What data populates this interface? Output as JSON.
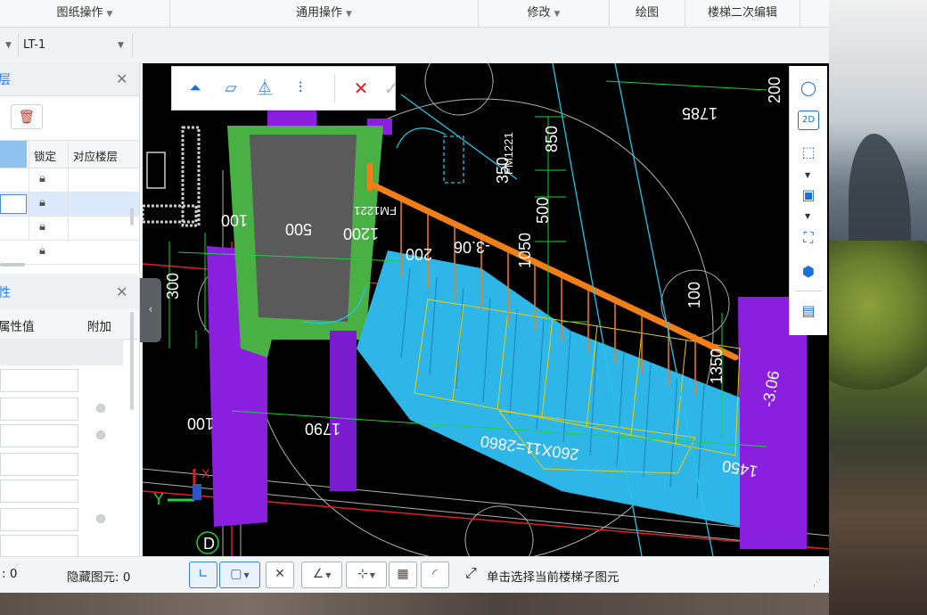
{
  "ribbon": {
    "groups": [
      {
        "label": "图纸操作"
      },
      {
        "label": "通用操作"
      },
      {
        "label": "修改"
      },
      {
        "label": "绘图"
      },
      {
        "label": "楼梯二次编辑"
      }
    ]
  },
  "toolbar": {
    "combo_left": "",
    "combo_stair": "LT-1"
  },
  "layer_panel": {
    "title": "层",
    "columns": [
      "锁定",
      "对应楼层"
    ],
    "rows": [
      {
        "locked": true
      },
      {
        "locked": true,
        "active": true
      },
      {
        "locked": true
      },
      {
        "locked": true
      }
    ]
  },
  "property_panel": {
    "title": "性",
    "columns": [
      "属性值",
      "附加"
    ]
  },
  "canvas": {
    "dimensions": [
      "1785",
      "200",
      "850",
      "350",
      "500",
      "1050",
      "1200",
      "1200",
      "500",
      "100",
      "300",
      "100",
      "1790",
      "260X11=2860",
      "1450",
      "1350",
      "-3.06",
      "200",
      "100",
      "100"
    ],
    "labels": [
      "FM1221",
      "FM1221"
    ],
    "axis_label": "D",
    "y_axis": "Y",
    "x_axis": "X"
  },
  "status": {
    "count_label": ": 0",
    "hidden_label": "隐藏图元: 0",
    "hint": "单击选择当前楼梯子图元"
  },
  "colors": {
    "accent": "#1c6fd6",
    "stair_cyan": "#2fb6e8",
    "wall_purple": "#8a1fe0",
    "wall_green": "#49b043",
    "rail_orange": "#f07f1a",
    "dim_green": "#19d43a"
  }
}
